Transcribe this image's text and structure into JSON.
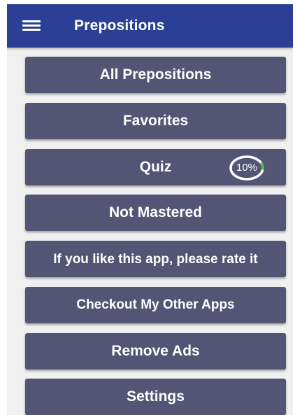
{
  "appbar": {
    "title": "Prepositions",
    "menu_icon": "hamburger-menu-icon"
  },
  "menu": {
    "items": [
      {
        "label": "All Prepositions"
      },
      {
        "label": "Favorites"
      },
      {
        "label": "Quiz",
        "progress_label": "10%",
        "progress": 0.1
      },
      {
        "label": "Not Mastered"
      },
      {
        "label": "If you like this app, please rate it"
      },
      {
        "label": "Checkout My Other Apps"
      },
      {
        "label": "Remove Ads"
      },
      {
        "label": "Settings"
      }
    ]
  },
  "colors": {
    "appbar": "#2c3f97",
    "button": "#545474",
    "background": "#f0f0f0",
    "progress_track": "#ffffff",
    "progress_fill": "#3ec24a"
  }
}
